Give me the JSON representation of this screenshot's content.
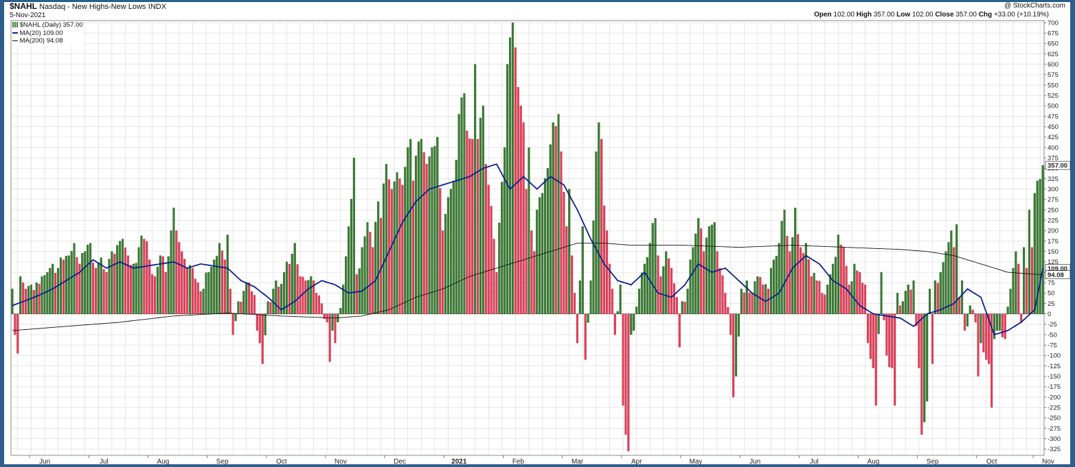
{
  "header": {
    "symbol": "$NAHL",
    "description": "Nasdaq - New Highs-New Lows",
    "exchange": "INDX",
    "credit": "@ StockCharts.com",
    "date": "5-Nov-2021",
    "ohlc": {
      "open_label": "Open",
      "open": "102.00",
      "high_label": "High",
      "high": "357.00",
      "low_label": "Low",
      "low": "102.00",
      "close_label": "Close",
      "close": "357.00",
      "chg_label": "Chg",
      "chg": "+33.00 (+10.19%)"
    }
  },
  "legend": {
    "series_label": "$NAHL (Daily) 357.00",
    "ma20_label": "MA(20) 109.00",
    "ma200_label": "MA(200) 94.08"
  },
  "colors": {
    "up": "#3a7d32",
    "down": "#e0405a",
    "ma20": "#0b1f8c",
    "ma200": "#111111",
    "frame": "#2f5e8c",
    "grid": "#d6d6d6"
  },
  "chart_data": {
    "type": "bar",
    "ylim": [
      -340,
      705
    ],
    "y_ticks": [
      700,
      675,
      650,
      625,
      600,
      575,
      550,
      525,
      500,
      475,
      450,
      425,
      400,
      375,
      350,
      325,
      300,
      275,
      250,
      225,
      200,
      175,
      150,
      125,
      100,
      75,
      50,
      25,
      0,
      -25,
      -50,
      -75,
      -100,
      -125,
      -150,
      -175,
      -200,
      -225,
      -250,
      -275,
      -300,
      -325
    ],
    "x_labels": [
      "Jun",
      "Jul",
      "Aug",
      "Sep",
      "Oct",
      "Nov",
      "Dec",
      "2021",
      "Feb",
      "Mar",
      "Apr",
      "May",
      "Jun",
      "Jul",
      "Aug",
      "Sep",
      "Oct",
      "Nov"
    ],
    "x_label_positions": [
      10,
      32,
      54,
      76,
      98,
      120,
      142,
      164,
      186,
      208,
      230,
      252,
      274,
      296,
      318,
      340,
      362,
      383
    ],
    "bold_labels": [
      "2021"
    ],
    "bar_count": 374,
    "anchors": [
      [
        0,
        60
      ],
      [
        1,
        -50
      ],
      [
        2,
        -95
      ],
      [
        3,
        90
      ],
      [
        5,
        60
      ],
      [
        7,
        70
      ],
      [
        9,
        75
      ],
      [
        11,
        90
      ],
      [
        13,
        100
      ],
      [
        15,
        120
      ],
      [
        17,
        110
      ],
      [
        19,
        130
      ],
      [
        21,
        140
      ],
      [
        23,
        170
      ],
      [
        25,
        120
      ],
      [
        27,
        150
      ],
      [
        29,
        170
      ],
      [
        31,
        110
      ],
      [
        33,
        135
      ],
      [
        35,
        100
      ],
      [
        37,
        150
      ],
      [
        39,
        165
      ],
      [
        41,
        180
      ],
      [
        43,
        140
      ],
      [
        45,
        120
      ],
      [
        47,
        160
      ],
      [
        49,
        180
      ],
      [
        51,
        130
      ],
      [
        53,
        90
      ],
      [
        55,
        140
      ],
      [
        57,
        100
      ],
      [
        59,
        200
      ],
      [
        60,
        255
      ],
      [
        61,
        200
      ],
      [
        63,
        150
      ],
      [
        65,
        110
      ],
      [
        67,
        110
      ],
      [
        69,
        75
      ],
      [
        71,
        60
      ],
      [
        73,
        100
      ],
      [
        75,
        130
      ],
      [
        77,
        170
      ],
      [
        79,
        130
      ],
      [
        80,
        190
      ],
      [
        81,
        60
      ],
      [
        82,
        -50
      ],
      [
        84,
        30
      ],
      [
        86,
        55
      ],
      [
        88,
        75
      ],
      [
        90,
        45
      ],
      [
        91,
        -40
      ],
      [
        92,
        -70
      ],
      [
        93,
        -120
      ],
      [
        95,
        30
      ],
      [
        97,
        60
      ],
      [
        99,
        65
      ],
      [
        101,
        100
      ],
      [
        103,
        120
      ],
      [
        105,
        170
      ],
      [
        107,
        90
      ],
      [
        109,
        80
      ],
      [
        111,
        90
      ],
      [
        113,
        50
      ],
      [
        115,
        25
      ],
      [
        117,
        -20
      ],
      [
        118,
        -115
      ],
      [
        119,
        -40
      ],
      [
        120,
        -70
      ],
      [
        121,
        -20
      ],
      [
        123,
        70
      ],
      [
        125,
        210
      ],
      [
        127,
        375
      ],
      [
        128,
        95
      ],
      [
        130,
        160
      ],
      [
        132,
        220
      ],
      [
        134,
        160
      ],
      [
        136,
        270
      ],
      [
        137,
        230
      ],
      [
        139,
        360
      ],
      [
        141,
        300
      ],
      [
        143,
        340
      ],
      [
        145,
        310
      ],
      [
        147,
        400
      ],
      [
        148,
        420
      ],
      [
        149,
        320
      ],
      [
        150,
        380
      ],
      [
        152,
        420
      ],
      [
        154,
        360
      ],
      [
        156,
        400
      ],
      [
        158,
        425
      ],
      [
        160,
        200
      ],
      [
        161,
        240
      ],
      [
        163,
        300
      ],
      [
        165,
        370
      ],
      [
        166,
        480
      ],
      [
        167,
        520
      ],
      [
        168,
        530
      ],
      [
        169,
        440
      ],
      [
        171,
        420
      ],
      [
        172,
        600
      ],
      [
        173,
        420
      ],
      [
        175,
        500
      ],
      [
        176,
        360
      ],
      [
        177,
        310
      ],
      [
        179,
        180
      ],
      [
        180,
        100
      ],
      [
        183,
        400
      ],
      [
        184,
        600
      ],
      [
        186,
        700
      ],
      [
        187,
        640
      ],
      [
        188,
        545
      ],
      [
        189,
        500
      ],
      [
        190,
        460
      ],
      [
        191,
        300
      ],
      [
        192,
        400
      ],
      [
        193,
        200
      ],
      [
        194,
        150
      ],
      [
        195,
        250
      ],
      [
        197,
        290
      ],
      [
        199,
        350
      ],
      [
        201,
        460
      ],
      [
        203,
        480
      ],
      [
        204,
        390
      ],
      [
        206,
        210
      ],
      [
        207,
        300
      ],
      [
        208,
        140
      ],
      [
        209,
        50
      ],
      [
        210,
        -70
      ],
      [
        211,
        80
      ],
      [
        212,
        210
      ],
      [
        213,
        -110
      ],
      [
        215,
        80
      ],
      [
        217,
        390
      ],
      [
        218,
        460
      ],
      [
        219,
        420
      ],
      [
        220,
        260
      ],
      [
        221,
        200
      ],
      [
        222,
        120
      ],
      [
        223,
        60
      ],
      [
        224,
        -50
      ],
      [
        226,
        70
      ],
      [
        227,
        -220
      ],
      [
        228,
        -290
      ],
      [
        229,
        -330
      ],
      [
        230,
        -50
      ],
      [
        231,
        -40
      ],
      [
        233,
        60
      ],
      [
        235,
        120
      ],
      [
        237,
        170
      ],
      [
        239,
        230
      ],
      [
        241,
        90
      ],
      [
        243,
        150
      ],
      [
        245,
        110
      ],
      [
        247,
        40
      ],
      [
        248,
        -80
      ],
      [
        249,
        30
      ],
      [
        251,
        60
      ],
      [
        253,
        160
      ],
      [
        255,
        230
      ],
      [
        257,
        150
      ],
      [
        259,
        210
      ],
      [
        261,
        220
      ],
      [
        263,
        110
      ],
      [
        265,
        50
      ],
      [
        267,
        -50
      ],
      [
        268,
        -200
      ],
      [
        269,
        -150
      ],
      [
        271,
        60
      ],
      [
        273,
        80
      ],
      [
        275,
        50
      ],
      [
        277,
        90
      ],
      [
        279,
        70
      ],
      [
        281,
        60
      ],
      [
        283,
        130
      ],
      [
        285,
        170
      ],
      [
        287,
        250
      ],
      [
        289,
        150
      ],
      [
        291,
        255
      ],
      [
        293,
        160
      ],
      [
        295,
        170
      ],
      [
        297,
        90
      ],
      [
        299,
        80
      ],
      [
        301,
        50
      ],
      [
        303,
        70
      ],
      [
        305,
        120
      ],
      [
        307,
        190
      ],
      [
        309,
        160
      ],
      [
        311,
        70
      ],
      [
        313,
        120
      ],
      [
        315,
        100
      ],
      [
        317,
        70
      ],
      [
        318,
        -70
      ],
      [
        320,
        -130
      ],
      [
        321,
        -220
      ],
      [
        323,
        100
      ],
      [
        325,
        -100
      ],
      [
        327,
        -130
      ],
      [
        328,
        -220
      ],
      [
        329,
        50
      ],
      [
        331,
        30
      ],
      [
        333,
        70
      ],
      [
        335,
        80
      ],
      [
        337,
        -130
      ],
      [
        338,
        -290
      ],
      [
        339,
        -260
      ],
      [
        340,
        -210
      ],
      [
        341,
        60
      ],
      [
        342,
        -120
      ],
      [
        343,
        80
      ],
      [
        345,
        100
      ],
      [
        347,
        150
      ],
      [
        349,
        200
      ],
      [
        350,
        160
      ],
      [
        351,
        215
      ],
      [
        352,
        40
      ],
      [
        353,
        80
      ],
      [
        354,
        -40
      ],
      [
        356,
        20
      ],
      [
        358,
        -20
      ],
      [
        359,
        -150
      ],
      [
        360,
        -70
      ],
      [
        362,
        -110
      ],
      [
        363,
        -120
      ],
      [
        364,
        -225
      ],
      [
        365,
        -60
      ],
      [
        367,
        -40
      ],
      [
        369,
        -60
      ],
      [
        371,
        60
      ],
      [
        372,
        110
      ],
      [
        373,
        150
      ],
      [
        374,
        120
      ],
      [
        375,
        -20
      ],
      [
        376,
        160
      ],
      [
        377,
        110
      ],
      [
        378,
        250
      ],
      [
        379,
        160
      ],
      [
        380,
        290
      ],
      [
        381,
        320
      ],
      [
        382,
        324
      ],
      [
        383,
        357
      ]
    ],
    "ma20_anchors": [
      [
        0,
        20
      ],
      [
        5,
        32
      ],
      [
        10,
        45
      ],
      [
        15,
        60
      ],
      [
        20,
        80
      ],
      [
        25,
        100
      ],
      [
        30,
        130
      ],
      [
        35,
        110
      ],
      [
        40,
        125
      ],
      [
        45,
        110
      ],
      [
        50,
        115
      ],
      [
        55,
        120
      ],
      [
        60,
        125
      ],
      [
        65,
        110
      ],
      [
        70,
        120
      ],
      [
        75,
        115
      ],
      [
        80,
        110
      ],
      [
        85,
        80
      ],
      [
        90,
        65
      ],
      [
        95,
        40
      ],
      [
        100,
        10
      ],
      [
        105,
        30
      ],
      [
        110,
        60
      ],
      [
        115,
        80
      ],
      [
        120,
        70
      ],
      [
        125,
        50
      ],
      [
        130,
        55
      ],
      [
        135,
        80
      ],
      [
        140,
        150
      ],
      [
        145,
        220
      ],
      [
        150,
        270
      ],
      [
        155,
        300
      ],
      [
        160,
        310
      ],
      [
        165,
        320
      ],
      [
        170,
        330
      ],
      [
        175,
        350
      ],
      [
        180,
        360
      ],
      [
        185,
        300
      ],
      [
        190,
        330
      ],
      [
        195,
        300
      ],
      [
        200,
        330
      ],
      [
        205,
        310
      ],
      [
        210,
        250
      ],
      [
        215,
        180
      ],
      [
        220,
        120
      ],
      [
        225,
        80
      ],
      [
        230,
        70
      ],
      [
        235,
        100
      ],
      [
        240,
        50
      ],
      [
        245,
        40
      ],
      [
        250,
        70
      ],
      [
        255,
        120
      ],
      [
        260,
        100
      ],
      [
        265,
        110
      ],
      [
        270,
        80
      ],
      [
        275,
        50
      ],
      [
        280,
        30
      ],
      [
        285,
        50
      ],
      [
        290,
        110
      ],
      [
        295,
        140
      ],
      [
        300,
        120
      ],
      [
        305,
        80
      ],
      [
        310,
        60
      ],
      [
        315,
        20
      ],
      [
        320,
        0
      ],
      [
        325,
        -5
      ],
      [
        330,
        -10
      ],
      [
        335,
        -30
      ],
      [
        340,
        0
      ],
      [
        345,
        10
      ],
      [
        350,
        25
      ],
      [
        355,
        60
      ],
      [
        360,
        40
      ],
      [
        365,
        -50
      ],
      [
        370,
        -40
      ],
      [
        375,
        -20
      ],
      [
        380,
        10
      ],
      [
        383,
        109
      ]
    ],
    "ma200_anchors": [
      [
        0,
        -40
      ],
      [
        20,
        -30
      ],
      [
        40,
        -20
      ],
      [
        60,
        -5
      ],
      [
        80,
        2
      ],
      [
        100,
        -5
      ],
      [
        120,
        -10
      ],
      [
        130,
        -5
      ],
      [
        140,
        10
      ],
      [
        150,
        40
      ],
      [
        160,
        60
      ],
      [
        170,
        90
      ],
      [
        180,
        110
      ],
      [
        190,
        130
      ],
      [
        200,
        150
      ],
      [
        210,
        170
      ],
      [
        220,
        170
      ],
      [
        230,
        165
      ],
      [
        250,
        165
      ],
      [
        270,
        160
      ],
      [
        290,
        165
      ],
      [
        310,
        160
      ],
      [
        330,
        155
      ],
      [
        340,
        150
      ],
      [
        350,
        140
      ],
      [
        360,
        120
      ],
      [
        370,
        100
      ],
      [
        383,
        94
      ]
    ],
    "last_value_label": "357.00",
    "ma20_value_label": "109.00",
    "ma200_value_label": "94.08"
  }
}
